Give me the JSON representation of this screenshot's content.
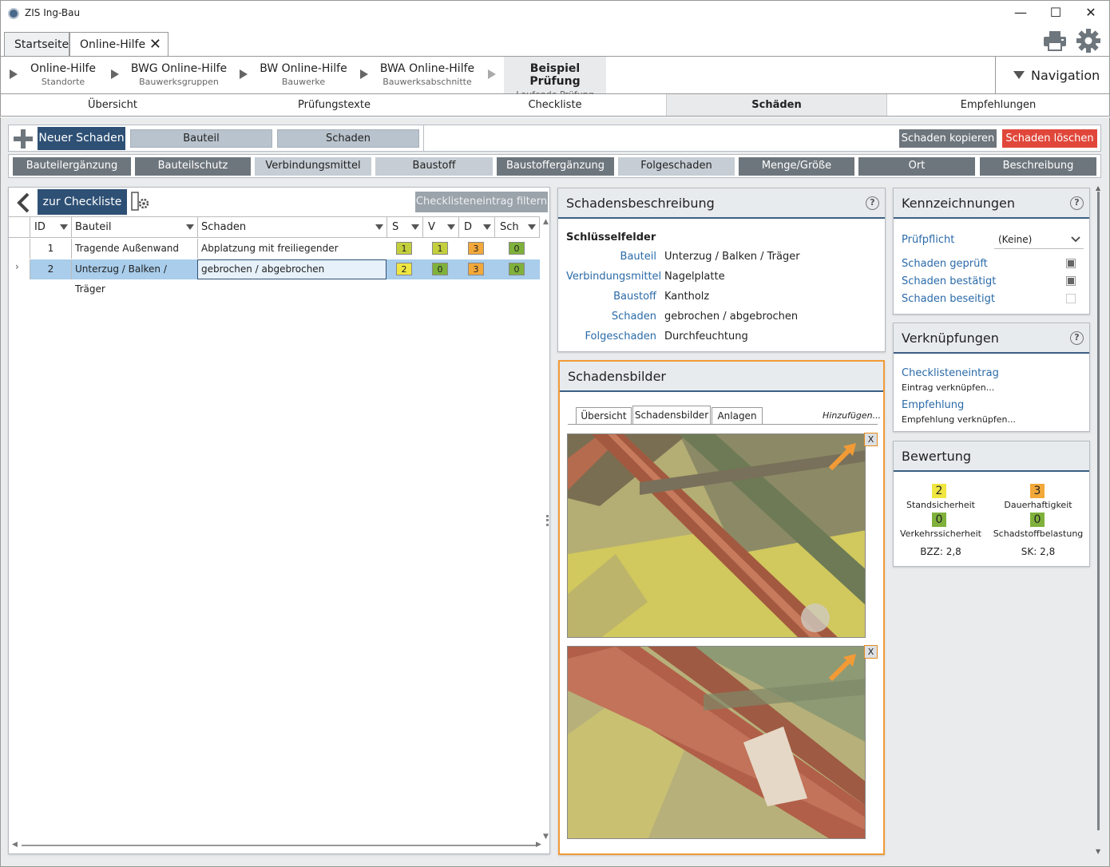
{
  "window": {
    "title": "ZIS Ing-Bau",
    "minimize": "—",
    "maximize": "☐",
    "close": "✕"
  },
  "tabs": [
    {
      "label": "Startseite"
    },
    {
      "label": "Online-Hilfe",
      "close": "✕"
    }
  ],
  "breadcrumbs": [
    {
      "title": "Online-Hilfe",
      "sub": "Standorte"
    },
    {
      "title": "BWG Online-Hilfe",
      "sub": "Bauwerksgruppen"
    },
    {
      "title": "BW Online-Hilfe",
      "sub": "Bauwerke"
    },
    {
      "title": "BWA Online-Hilfe",
      "sub": "Bauwerksabschnitte"
    },
    {
      "title": "Beispiel Prüfung",
      "sub": "Laufende Prüfung"
    }
  ],
  "navigation_label": "Navigation",
  "subtabs": [
    "Übersicht",
    "Prüfungstexte",
    "Checkliste",
    "Schäden",
    "Empfehlungen"
  ],
  "toolbar": {
    "new_damage": "Neuer Schaden",
    "bauteil": "Bauteil",
    "schaden": "Schaden",
    "copy": "Schaden kopieren",
    "delete": "Schaden löschen"
  },
  "categories": [
    "Bauteilergänzung",
    "Bauteilschutz",
    "Verbindungsmittel",
    "Baustoff",
    "Baustoffergänzung",
    "Folgeschaden",
    "Menge/Größe",
    "Ort",
    "Beschreibung"
  ],
  "checklist": {
    "back_label": "zur Checkliste",
    "filter_button": "Checklisteneintrag filtern",
    "columns": [
      "ID",
      "Bauteil",
      "Schaden",
      "S",
      "V",
      "D",
      "Sch"
    ],
    "rows": [
      {
        "id": "1",
        "bauteil": "Tragende Außenwand",
        "schaden": "Abplatzung mit freiliegender Bewehrung",
        "s": "1",
        "v": "1",
        "d": "3",
        "sch": "0"
      },
      {
        "id": "2",
        "bauteil": "Unterzug / Balken / Träger",
        "schaden": "gebrochen / abgebrochen",
        "s": "2",
        "v": "0",
        "d": "3",
        "sch": "0"
      }
    ],
    "selected_marker": "›"
  },
  "description": {
    "title": "Schadensbeschreibung",
    "section": "Schlüsselfelder",
    "fields": [
      {
        "label": "Bauteil",
        "value": "Unterzug / Balken / Träger"
      },
      {
        "label": "Verbindungsmittel",
        "value": "Nagelplatte"
      },
      {
        "label": "Baustoff",
        "value": "Kantholz"
      },
      {
        "label": "Schaden",
        "value": "gebrochen / abgebrochen"
      },
      {
        "label": "Folgeschaden",
        "value": "Durchfeuchtung"
      }
    ]
  },
  "images": {
    "title": "Schadensbilder",
    "tabs": [
      "Übersicht",
      "Schadensbilder",
      "Anlagen"
    ],
    "add": "Hinzufügen...",
    "remove": "X"
  },
  "markings": {
    "title": "Kennzeichnungen",
    "pruefpflicht_label": "Prüfpflicht",
    "pruefpflicht_value": "(Keine)",
    "checks": [
      {
        "label": "Schaden geprüft",
        "checked": true
      },
      {
        "label": "Schaden bestätigt",
        "checked": true
      },
      {
        "label": "Schaden beseitigt",
        "checked": false
      }
    ]
  },
  "links": {
    "title": "Verknüpfungen",
    "items": [
      {
        "label": "Checklisteneintrag",
        "sub": "Eintrag verknüpfen..."
      },
      {
        "label": "Empfehlung",
        "sub": "Empfehlung verknüpfen..."
      }
    ]
  },
  "rating": {
    "title": "Bewertung",
    "items": [
      {
        "value": "2",
        "label": "Standsicherheit",
        "color": "#f0e641"
      },
      {
        "value": "3",
        "label": "Dauerhaftigkeit",
        "color": "#f3a83a"
      },
      {
        "value": "0",
        "label": "Verkehrssicherheit",
        "color": "#7fb13b"
      },
      {
        "value": "0",
        "label": "Schadstoffbelastung",
        "color": "#7fb13b"
      }
    ],
    "bzz": "BZZ: 2,8",
    "sk": "SK: 2,8"
  },
  "help_symbol": "?"
}
